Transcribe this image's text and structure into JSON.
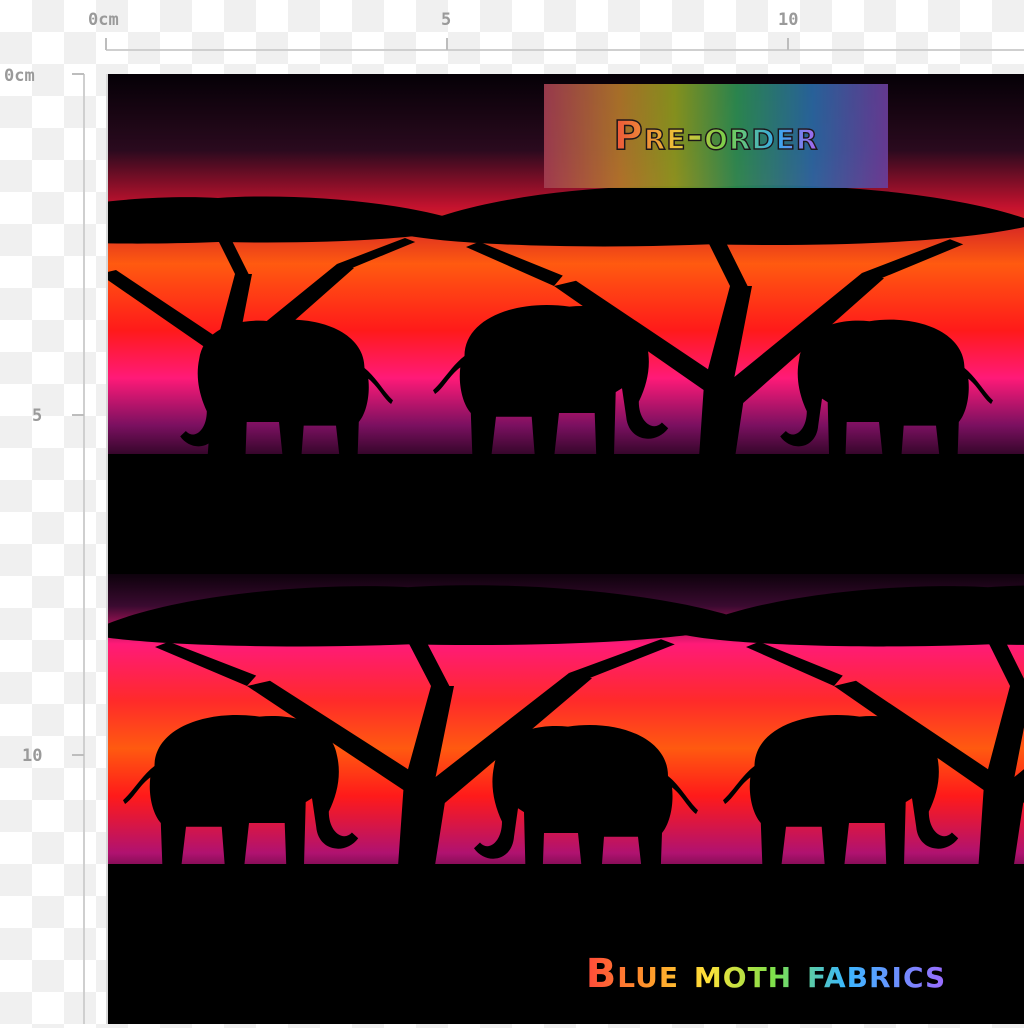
{
  "ruler": {
    "top_labels": [
      "0cm",
      "5",
      "10"
    ],
    "left_labels": [
      "0cm",
      "5",
      "10"
    ]
  },
  "overlay": {
    "preorder_label": "Pre-order",
    "brand_label": "Blue moth fabrics"
  },
  "colors": {
    "sky_red": "#ff1a1a",
    "sky_orange": "#ff5a10",
    "sky_magenta": "#ff1a78",
    "sky_purple": "#7a1060",
    "silhouette": "#000000"
  }
}
